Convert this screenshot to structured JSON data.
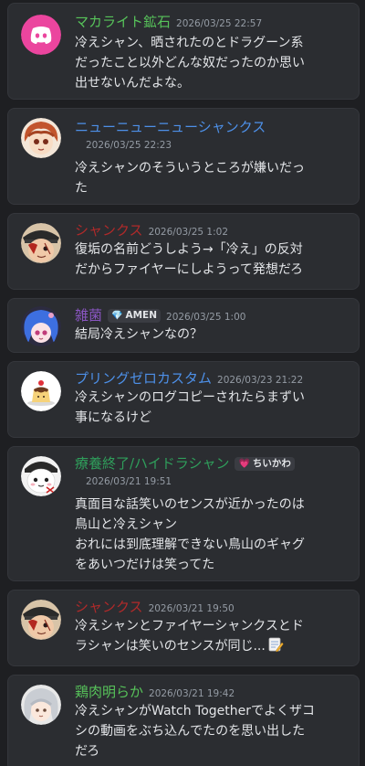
{
  "messages": [
    {
      "author": "マカライト鉱石",
      "author_color": "#57c35a",
      "time": "2026/03/25 22:57",
      "avatar_icon": "discord-logo-icon",
      "lines": [
        "冷えシャン、晒されたのとドラグーン系",
        "だったこと以外どんな奴だったのか思い",
        "出せないんだよな。"
      ]
    },
    {
      "author": "ニューニューニューシャンクス",
      "author_color": "#4d90e8",
      "time": "2026/03/25 22:23",
      "avatar_icon": "anime-girl-avatar-icon",
      "lines": [
        "冷えシャンのそういうところが嫌いだっ",
        "た"
      ]
    },
    {
      "author": "シャンクス",
      "author_color": "#b02a2a",
      "time": "2026/03/25 1:02",
      "avatar_icon": "pirate-avatar-icon",
      "lines": [
        "復垢の名前どうしよう→「冷え」の反対",
        "だからファイヤーにしようって発想だろ"
      ]
    },
    {
      "author": "雑菌",
      "author_color": "#8a56c2",
      "tag": "AMEN",
      "tag_icon": "gem-icon",
      "time": "2026/03/25 1:00",
      "avatar_icon": "blue-hair-avatar-icon",
      "lines": [
        "結局冷えシャンなの？"
      ]
    },
    {
      "author": "プリングゼロカスタム",
      "author_color": "#4d90e8",
      "time": "2026/03/23 21:22",
      "avatar_icon": "pudding-avatar-icon",
      "lines": [
        "冷えシャンのログコピーされたらまずい",
        "事になるけど"
      ]
    },
    {
      "author": "療養終了/ハイドラシャン",
      "author_color": "#2f9e5b",
      "tag": "ちいかわ",
      "tag_icon": "heart-icon",
      "time": "2026/03/21 19:51",
      "avatar_icon": "chiikawa-avatar-icon",
      "lines": [
        "真面目な話笑いのセンスが近かったのは",
        "鳥山と冷えシャン",
        "おれには到底理解できない鳥山のギャグ",
        "をあいつだけは笑ってた"
      ]
    },
    {
      "author": "シャンクス",
      "author_color": "#b02a2a",
      "time": "2026/03/21 19:50",
      "avatar_icon": "pirate-avatar-icon",
      "lines": [
        "冷えシャンとファイヤーシャンクスとド",
        "ラシャンは笑いのセンスが同じ..."
      ],
      "trailing_icon": "memo-icon"
    },
    {
      "author": "鶏肉明らか",
      "author_color": "#57c35a",
      "time": "2026/03/21 19:42",
      "avatar_icon": "silver-hair-avatar-icon",
      "lines": [
        "冷えシャンがWatch Togetherでよくザコ",
        "シの動画をぶち込んでたのを思い出した",
        "だろ"
      ]
    }
  ],
  "colors": {
    "background": "#1e1f22",
    "card": "#2b2d31",
    "timestamp": "#949ba4",
    "discord_blurple": "#eb459e"
  }
}
